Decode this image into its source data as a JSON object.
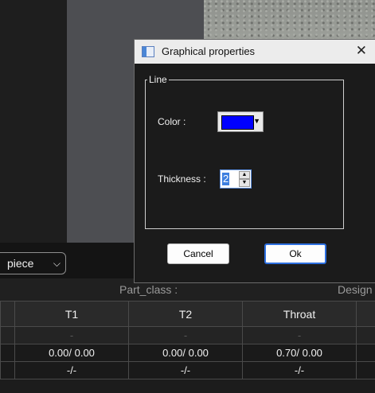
{
  "view": {
    "selected": "piece"
  },
  "part_row": {
    "part_class": "Part_class :",
    "design": "Design"
  },
  "table": {
    "headers": [
      "",
      "T1",
      "T2",
      "Throat",
      ""
    ],
    "rows": [
      [
        "",
        "-",
        "-",
        "-",
        ""
      ],
      [
        "",
        "0.00/ 0.00",
        "0.00/ 0.00",
        "0.70/ 0.00",
        ""
      ],
      [
        "",
        "-/-",
        "-/-",
        "-/-",
        ""
      ]
    ]
  },
  "dialog": {
    "title": "Graphical properties",
    "close": "✕",
    "group_label": "Line",
    "color_label": "Color :",
    "color_value": "#0000ff",
    "thickness_label": "Thickness :",
    "thickness_value": "2",
    "cancel_label": "Cancel",
    "ok_label": "Ok"
  },
  "icons": {
    "dialog_icon": "window-icon",
    "dropdown": "chevron-down-icon",
    "spin_up": "spin-up-icon",
    "spin_down": "spin-down-icon"
  }
}
